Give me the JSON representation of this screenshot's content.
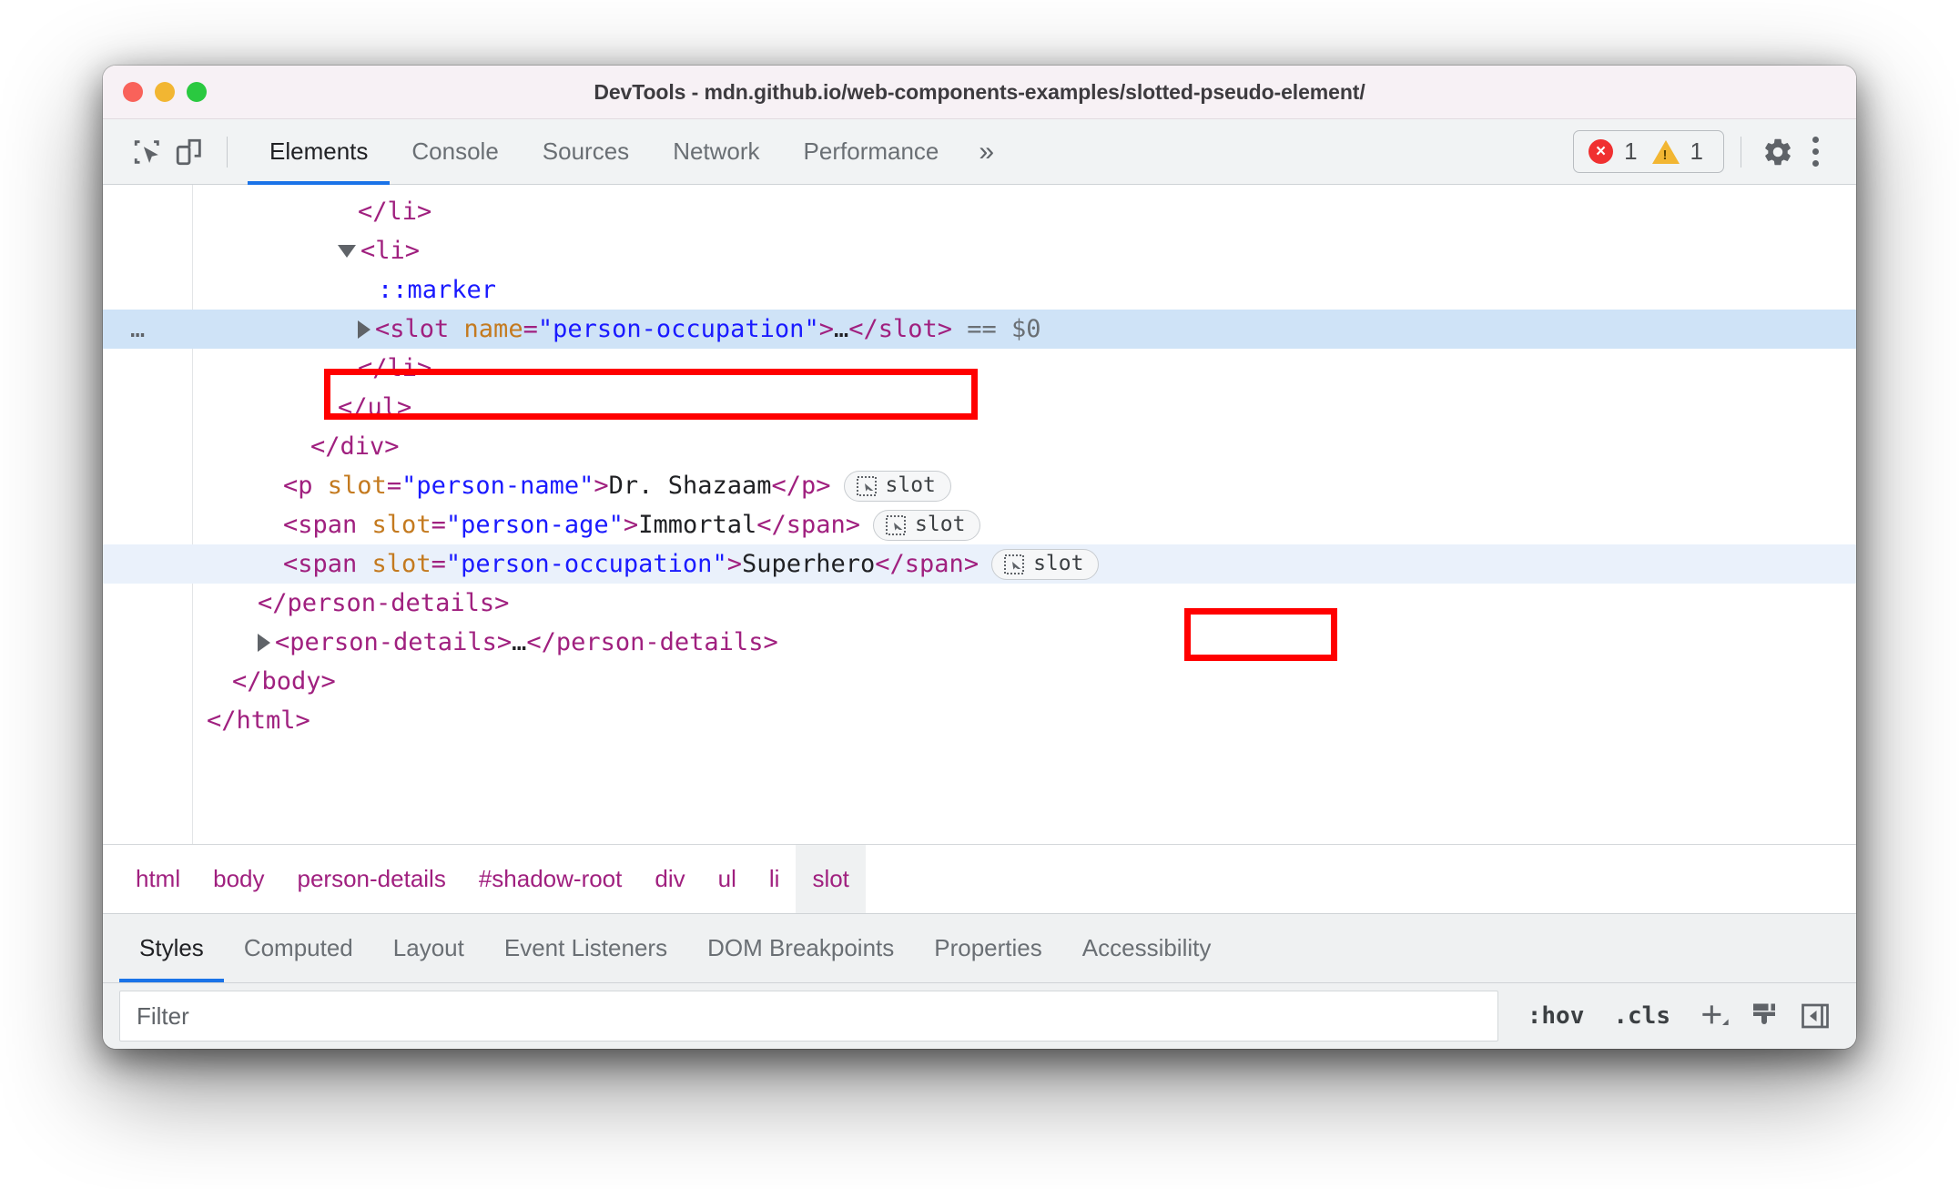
{
  "window": {
    "title": "DevTools - mdn.github.io/web-components-examples/slotted-pseudo-element/",
    "traffic_lights": [
      "close-button",
      "minimize-button",
      "zoom-button"
    ]
  },
  "toolbar": {
    "inspect_icon": "inspect-element-icon",
    "device_icon": "device-toolbar-icon",
    "tabs": [
      {
        "label": "Elements",
        "active": true
      },
      {
        "label": "Console",
        "active": false
      },
      {
        "label": "Sources",
        "active": false
      },
      {
        "label": "Network",
        "active": false
      },
      {
        "label": "Performance",
        "active": false
      }
    ],
    "more_tabs_label": "»",
    "issues": {
      "error_glyph": "×",
      "error_count": "1",
      "warning_glyph": "!",
      "warning_count": "1"
    },
    "settings_icon": "gear-icon",
    "menu_icon": "kebab-menu-icon"
  },
  "dom_tree": {
    "rows": [
      {
        "id": "close-li-1",
        "indent": 170,
        "state": "normal",
        "parts": [
          {
            "t": "tag",
            "v": "</li>"
          }
        ]
      },
      {
        "id": "open-li",
        "indent": 148,
        "state": "normal",
        "twisty": "open",
        "parts": [
          {
            "t": "tag",
            "v": "<li>"
          }
        ]
      },
      {
        "id": "marker-pseudo",
        "indent": 192,
        "state": "normal",
        "parts": [
          {
            "t": "pseudo",
            "v": "::marker"
          }
        ]
      },
      {
        "id": "slot-selected",
        "indent": 170,
        "state": "selected",
        "twisty": "closed",
        "dots": "…",
        "parts": [
          {
            "t": "tag",
            "v": "<slot "
          },
          {
            "t": "attr-name",
            "v": "name"
          },
          {
            "t": "tag",
            "v": "="
          },
          {
            "t": "attr-val",
            "v": "\"person-occupation\""
          },
          {
            "t": "tag",
            "v": ">"
          },
          {
            "t": "text-node",
            "v": "…"
          },
          {
            "t": "tag",
            "v": "</slot>"
          },
          {
            "t": "dollar",
            "v": " == $0"
          }
        ]
      },
      {
        "id": "close-li-2",
        "indent": 170,
        "state": "normal",
        "parts": [
          {
            "t": "tag",
            "v": "</li>"
          }
        ]
      },
      {
        "id": "close-ul",
        "indent": 148,
        "state": "normal",
        "parts": [
          {
            "t": "tag",
            "v": "</ul>"
          }
        ]
      },
      {
        "id": "close-div",
        "indent": 118,
        "state": "normal",
        "parts": [
          {
            "t": "tag",
            "v": "</div>"
          }
        ]
      },
      {
        "id": "p-person-name",
        "indent": 88,
        "state": "normal",
        "badge": "slot",
        "parts": [
          {
            "t": "tag",
            "v": "<p "
          },
          {
            "t": "attr-name",
            "v": "slot"
          },
          {
            "t": "tag",
            "v": "="
          },
          {
            "t": "attr-val",
            "v": "\"person-name\""
          },
          {
            "t": "tag",
            "v": ">"
          },
          {
            "t": "text-node",
            "v": "Dr. Shazaam"
          },
          {
            "t": "tag",
            "v": "</p>"
          }
        ]
      },
      {
        "id": "span-person-age",
        "indent": 88,
        "state": "normal",
        "badge": "slot",
        "parts": [
          {
            "t": "tag",
            "v": "<span "
          },
          {
            "t": "attr-name",
            "v": "slot"
          },
          {
            "t": "tag",
            "v": "="
          },
          {
            "t": "attr-val",
            "v": "\"person-age\""
          },
          {
            "t": "tag",
            "v": ">"
          },
          {
            "t": "text-node",
            "v": "Immortal"
          },
          {
            "t": "tag",
            "v": "</span>"
          }
        ]
      },
      {
        "id": "span-person-occupation",
        "indent": 88,
        "state": "highlighted",
        "badge": "slot",
        "parts": [
          {
            "t": "tag",
            "v": "<span "
          },
          {
            "t": "attr-name",
            "v": "slot"
          },
          {
            "t": "tag",
            "v": "="
          },
          {
            "t": "attr-val",
            "v": "\"person-occupation\""
          },
          {
            "t": "tag",
            "v": ">"
          },
          {
            "t": "text-node",
            "v": "Superhero"
          },
          {
            "t": "tag",
            "v": "</span>"
          }
        ]
      },
      {
        "id": "close-person-details",
        "indent": 60,
        "state": "normal",
        "parts": [
          {
            "t": "tag",
            "v": "</person-details>"
          }
        ]
      },
      {
        "id": "person-details-2",
        "indent": 60,
        "state": "normal",
        "twisty": "closed",
        "parts": [
          {
            "t": "tag",
            "v": "<person-details>"
          },
          {
            "t": "text-node",
            "v": "…"
          },
          {
            "t": "tag",
            "v": "</person-details>"
          }
        ]
      },
      {
        "id": "close-body",
        "indent": 32,
        "state": "normal",
        "parts": [
          {
            "t": "tag",
            "v": "</body>"
          }
        ]
      },
      {
        "id": "close-html",
        "indent": 4,
        "state": "normal",
        "parts": [
          {
            "t": "tag",
            "v": "</html>"
          }
        ]
      }
    ],
    "badge_label": "slot"
  },
  "breadcrumb": {
    "items": [
      {
        "label": "html",
        "active": false
      },
      {
        "label": "body",
        "active": false
      },
      {
        "label": "person-details",
        "active": false
      },
      {
        "label": "#shadow-root",
        "active": false
      },
      {
        "label": "div",
        "active": false
      },
      {
        "label": "ul",
        "active": false
      },
      {
        "label": "li",
        "active": false
      },
      {
        "label": "slot",
        "active": true
      }
    ]
  },
  "sidebar_tabs": {
    "items": [
      {
        "label": "Styles",
        "active": true
      },
      {
        "label": "Computed",
        "active": false
      },
      {
        "label": "Layout",
        "active": false
      },
      {
        "label": "Event Listeners",
        "active": false
      },
      {
        "label": "DOM Breakpoints",
        "active": false
      },
      {
        "label": "Properties",
        "active": false
      },
      {
        "label": "Accessibility",
        "active": false
      }
    ]
  },
  "filter_bar": {
    "placeholder": "Filter",
    "value": "",
    "hov_label": ":hov",
    "cls_label": ".cls",
    "new_rule_icon": "plus-icon",
    "style_icon": "paintbrush-icon",
    "sidebar_toggle_icon": "sidebar-toggle-icon"
  },
  "colors": {
    "accent": "#1a73e8",
    "annotation": "#ff0000",
    "tag": "#a0207f",
    "attr_name": "#c47a1f",
    "attr_value": "#1a1aff",
    "selection": "#cfe3f7",
    "error": "#f03030",
    "warning": "#f2b632"
  }
}
